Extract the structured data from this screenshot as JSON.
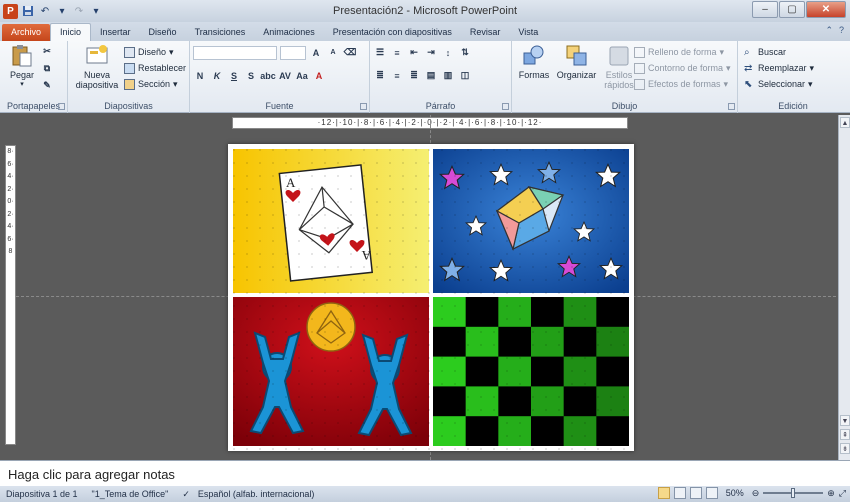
{
  "window": {
    "title": "Presentación2 - Microsoft PowerPoint",
    "app_logo_letter": "P"
  },
  "tabs": [
    {
      "label": "Archivo",
      "kind": "file"
    },
    {
      "label": "Inicio",
      "kind": "active"
    },
    {
      "label": "Insertar",
      "kind": "normal"
    },
    {
      "label": "Diseño",
      "kind": "normal"
    },
    {
      "label": "Transiciones",
      "kind": "normal"
    },
    {
      "label": "Animaciones",
      "kind": "normal"
    },
    {
      "label": "Presentación con diapositivas",
      "kind": "normal"
    },
    {
      "label": "Revisar",
      "kind": "normal"
    },
    {
      "label": "Vista",
      "kind": "normal"
    }
  ],
  "ribbon": {
    "portapapeles": {
      "label": "Portapapeles",
      "paste": "Pegar"
    },
    "diapositivas": {
      "label": "Diapositivas",
      "new_slide_1": "Nueva",
      "new_slide_2": "diapositiva",
      "layout": "Diseño",
      "reset": "Restablecer",
      "section": "Sección"
    },
    "fuente": {
      "label": "Fuente",
      "bold": "N",
      "italic": "K",
      "underline": "S",
      "strike": "S",
      "case": "Aa",
      "grow": "A",
      "shrink": "A"
    },
    "parrafo": {
      "label": "Párrafo"
    },
    "dibujo": {
      "label": "Dibujo",
      "shapes": "Formas",
      "arrange": "Organizar",
      "quick_styles_1": "Estilos",
      "quick_styles_2": "rápidos",
      "fill": "Relleno de forma",
      "outline": "Contorno de forma",
      "effects": "Efectos de formas"
    },
    "edicion": {
      "label": "Edición",
      "find": "Buscar",
      "replace": "Reemplazar",
      "select": "Seleccionar"
    }
  },
  "ruler": {
    "horizontal": "·12·|·10·|·8·|·6·|·4·|·2·|·0·|·2·|·4·|·6·|·8·|·10·|·12·",
    "vertical": "8·6·4·2·0·2·4·6·8"
  },
  "slide": {
    "card_rank_top": "A",
    "card_rank_bottom": "A"
  },
  "notes": {
    "placeholder": "Haga clic para agregar notas"
  },
  "status": {
    "slide_counter": "Diapositiva 1 de 1",
    "theme": "\"1_Tema de Office\"",
    "language": "Español (alfab. internacional)",
    "zoom": "50%"
  },
  "colors": {
    "yellow_bg": "#f7c800",
    "blue_bg": "#0e4fa8",
    "red_bg": "#b0000a",
    "green_check": "#2ccc1e",
    "figure_blue": "#1b94d6",
    "star_pink": "#d64bd6"
  }
}
